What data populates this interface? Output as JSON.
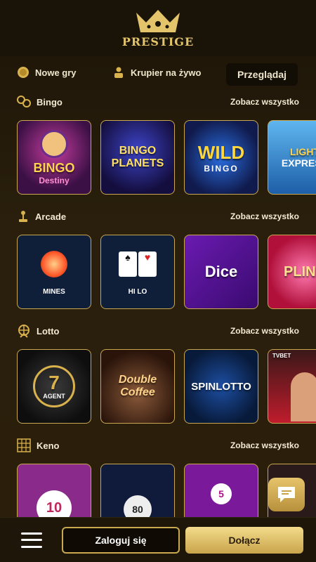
{
  "header": {
    "brand": "PRESTIGE"
  },
  "nav": {
    "items": [
      {
        "label": "Nowe gry",
        "icon": "new-games-icon"
      },
      {
        "label": "Krupier na żywo",
        "icon": "live-dealer-icon"
      },
      {
        "label": "Przeglądaj",
        "active": true
      }
    ]
  },
  "sections": [
    {
      "title": "Bingo",
      "icon": "bingo-icon",
      "see_all": "Zobacz wszystko",
      "tiles": [
        {
          "title": "BINGO",
          "sub": "Destiny"
        },
        {
          "title": "BINGO PLANETS",
          "sub": ""
        },
        {
          "title": "WILD",
          "sub": "BINGO"
        },
        {
          "title": "LIGHT",
          "sub": "EXPRESS"
        }
      ]
    },
    {
      "title": "Arcade",
      "icon": "joystick-icon",
      "see_all": "Zobacz wszystko",
      "tiles": [
        {
          "title": "MINES",
          "sub": ""
        },
        {
          "title": "HI LO",
          "sub": ""
        },
        {
          "title": "Dice",
          "sub": ""
        },
        {
          "title": "PLINK",
          "sub": ""
        }
      ]
    },
    {
      "title": "Lotto",
      "icon": "lotto-wheel-icon",
      "see_all": "Zobacz wszystko",
      "tiles": [
        {
          "title": "7",
          "sub": "AGENT"
        },
        {
          "title": "Double Coffee",
          "sub": ""
        },
        {
          "title": "SPINLOTTO",
          "sub": ""
        },
        {
          "title": "TVBET",
          "sub": ""
        }
      ]
    },
    {
      "title": "Keno",
      "icon": "keno-grid-icon",
      "see_all": "Zobacz wszystko",
      "tiles": [
        {
          "title": "10",
          "sub": ""
        },
        {
          "title": "80",
          "sub": ""
        },
        {
          "title": "5",
          "sub": ""
        },
        {
          "title": "",
          "sub": ""
        }
      ]
    }
  ],
  "bottom": {
    "login": "Zaloguj się",
    "join": "Dołącz"
  },
  "colors": {
    "accent": "#c9a84f",
    "background": "#2a1f0c"
  }
}
